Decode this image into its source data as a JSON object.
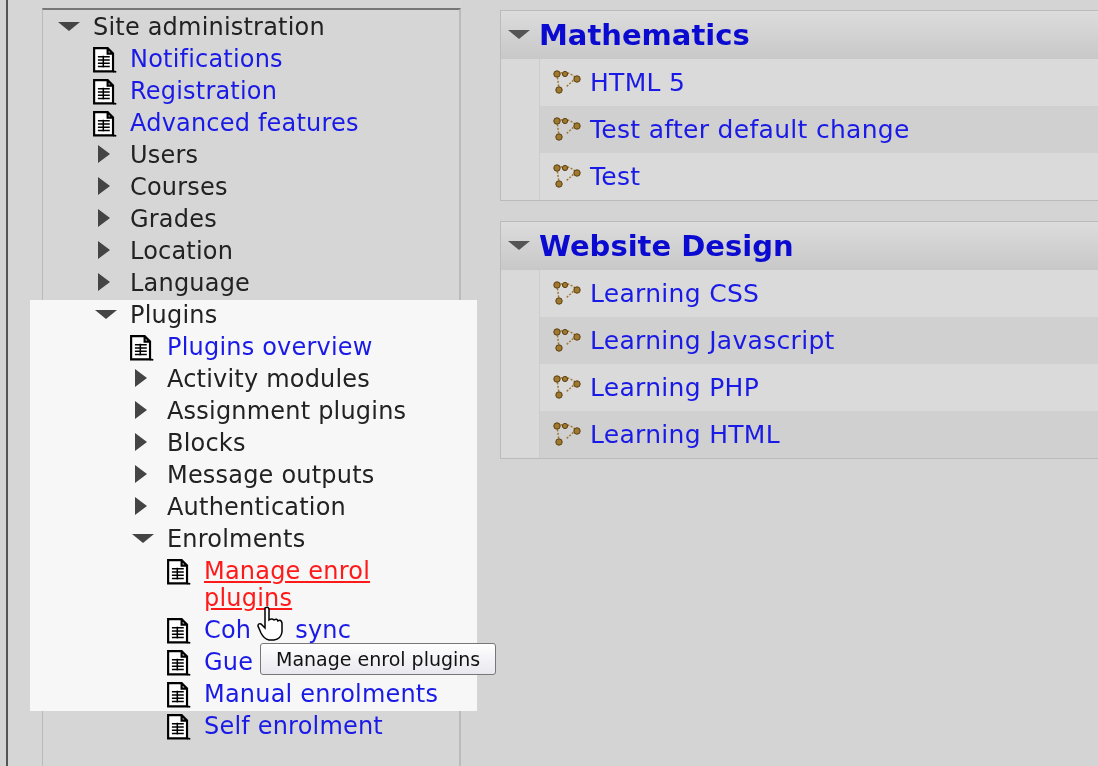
{
  "admin_tree": [
    {
      "kind": "folder",
      "label": "Site administration",
      "expanded": true,
      "highlighted": false,
      "children": [
        {
          "kind": "page",
          "label": "Notifications",
          "hovered": false,
          "highlighted": false
        },
        {
          "kind": "page",
          "label": "Registration",
          "hovered": false,
          "highlighted": false
        },
        {
          "kind": "page",
          "label": "Advanced features",
          "hovered": false,
          "highlighted": false
        },
        {
          "kind": "folder",
          "label": "Users",
          "expanded": false,
          "highlighted": false
        },
        {
          "kind": "folder",
          "label": "Courses",
          "expanded": false,
          "highlighted": false
        },
        {
          "kind": "folder",
          "label": "Grades",
          "expanded": false,
          "highlighted": false
        },
        {
          "kind": "folder",
          "label": "Location",
          "expanded": false,
          "highlighted": false
        },
        {
          "kind": "folder",
          "label": "Language",
          "expanded": false,
          "highlighted": false
        },
        {
          "kind": "folder",
          "label": "Plugins",
          "expanded": true,
          "highlighted": true,
          "children": [
            {
              "kind": "page",
              "label": "Plugins overview",
              "hovered": false,
              "highlighted": true
            },
            {
              "kind": "folder",
              "label": "Activity modules",
              "expanded": false,
              "highlighted": true
            },
            {
              "kind": "folder",
              "label": "Assignment plugins",
              "expanded": false,
              "highlighted": true
            },
            {
              "kind": "folder",
              "label": "Blocks",
              "expanded": false,
              "highlighted": true
            },
            {
              "kind": "folder",
              "label": "Message outputs",
              "expanded": false,
              "highlighted": true
            },
            {
              "kind": "folder",
              "label": "Authentication",
              "expanded": false,
              "highlighted": true
            },
            {
              "kind": "folder",
              "label": "Enrolments",
              "expanded": true,
              "highlighted": true,
              "children": [
                {
                  "kind": "page",
                  "label": "Manage enrol plugins",
                  "hovered": true,
                  "highlighted": true
                },
                {
                  "kind": "page",
                  "label": "Coh",
                  "label_tail": "sync",
                  "hovered": false,
                  "highlighted": true
                },
                {
                  "kind": "page",
                  "label": "Gue",
                  "hovered": false,
                  "highlighted": true
                },
                {
                  "kind": "page",
                  "label": "Manual enrolments",
                  "hovered": false,
                  "highlighted": true
                },
                {
                  "kind": "page",
                  "label": "Self enrolment",
                  "hovered": false,
                  "highlighted": false
                }
              ]
            }
          ]
        }
      ]
    }
  ],
  "tooltip": "Manage enrol plugins",
  "course_sections": [
    {
      "title": "Mathematics",
      "expanded": true,
      "items": [
        "HTML 5",
        "Test after default change",
        "Test"
      ]
    },
    {
      "title": "Website Design",
      "expanded": true,
      "items": [
        "Learning CSS",
        "Learning Javascript",
        "Learning PHP",
        "Learning HTML"
      ]
    }
  ]
}
